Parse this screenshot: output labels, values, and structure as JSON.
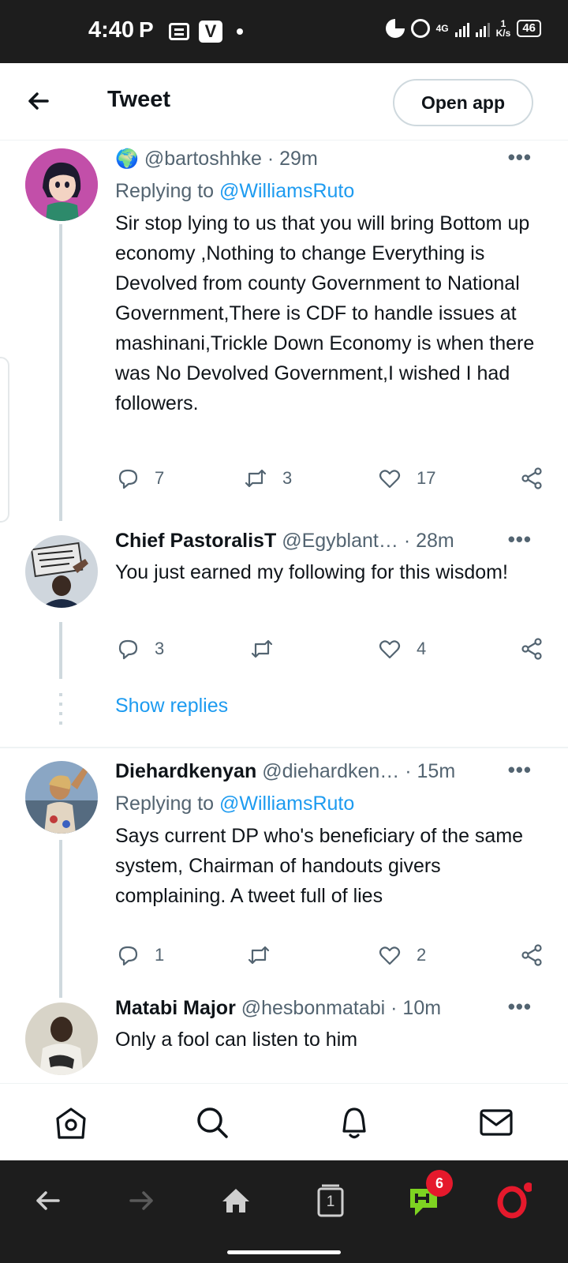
{
  "status_bar": {
    "time": "4:40",
    "p_icon": "P",
    "v_icon": "V",
    "network_type": "4G",
    "speed_value": "1",
    "speed_unit": "K/s",
    "battery": "46"
  },
  "header": {
    "back_icon": "back-arrow-icon",
    "title": "Tweet",
    "open_app_label": "Open app"
  },
  "tweets": [
    {
      "display_name": "",
      "emoji": "🌍",
      "handle": "@bartoshhke",
      "time": "· 29m",
      "replying_prefix": "Replying to",
      "replying_to": "@WilliamsRuto",
      "text": "Sir stop lying to us that you will bring Bottom up economy ,Nothing to change Everything is Devolved from county Government to National Government,There is CDF to handle issues at mashinani,Trickle Down Economy is when there was No Devolved Government,I wished I had followers.",
      "replies": "7",
      "retweets": "3",
      "likes": "17"
    },
    {
      "display_name": "Chief PastoralisT",
      "handle": "@Egyblant…",
      "time": "· 28m",
      "text": "You just earned my following for this wisdom!",
      "replies": "3",
      "retweets": "",
      "likes": "4"
    },
    {
      "display_name": "Diehardkenyan",
      "handle": "@diehardken…",
      "time": "· 15m",
      "replying_prefix": "Replying to",
      "replying_to": "@WilliamsRuto",
      "text": "Says current DP who's beneficiary of the same system, Chairman of handouts givers complaining. A tweet full of lies",
      "replies": "1",
      "retweets": "",
      "likes": "2"
    },
    {
      "display_name": "Matabi Major",
      "handle": "@hesbonmatabi",
      "time": "· 10m",
      "text": "Only a fool can listen to him"
    }
  ],
  "show_replies_label": "Show replies",
  "more_label": "•••",
  "tab_bar": [
    "home-icon",
    "search-icon",
    "notifications-bell-icon",
    "messages-envelope-icon"
  ],
  "browser_bar": {
    "tabs_count": "1",
    "notification_count": "6",
    "icons": [
      "back-arrow-icon",
      "forward-arrow-icon",
      "home-icon",
      "tabs-icon",
      "news-icon",
      "opera-icon"
    ]
  },
  "colors": {
    "link": "#1d9bf0",
    "muted": "#536471",
    "text": "#0f1419",
    "badge": "#e5192c",
    "opera": "#e5192c",
    "news_icon": "#7ed321"
  }
}
